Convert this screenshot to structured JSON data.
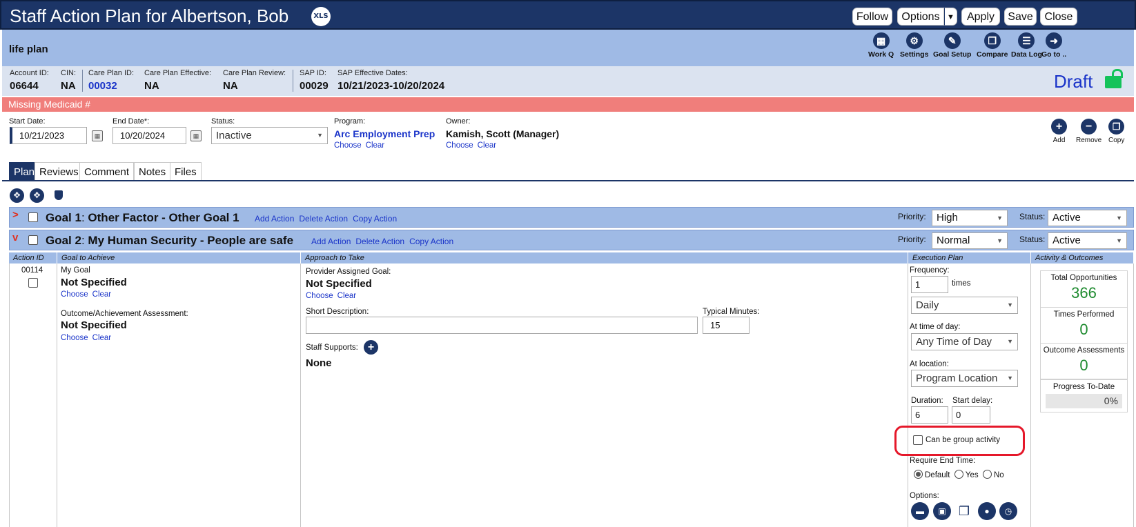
{
  "window": {
    "title": "Staff Action Plan for Albertson, Bob",
    "xls_badge": "XLS",
    "buttons": {
      "follow": "Follow",
      "options": "Options",
      "apply": "Apply",
      "save": "Save",
      "close": "Close"
    }
  },
  "plan_header": {
    "title": "life plan",
    "tools": [
      "Work Q",
      "Settings",
      "Goal Setup",
      "Compare",
      "Data Log",
      "Go to .."
    ]
  },
  "info": {
    "account_id": {
      "label": "Account ID:",
      "value": "06644"
    },
    "cin": {
      "label": "CIN:",
      "value": "NA"
    },
    "care_plan_id": {
      "label": "Care Plan ID:",
      "value": "00032"
    },
    "care_plan_effective": {
      "label": "Care Plan Effective:",
      "value": "NA"
    },
    "care_plan_review": {
      "label": "Care Plan Review:",
      "value": "NA"
    },
    "sap_id": {
      "label": "SAP ID:",
      "value": "00029"
    },
    "sap_effective": {
      "label": "SAP Effective Dates:",
      "value": "10/21/2023-10/20/2024"
    },
    "state": "Draft"
  },
  "alert": "Missing Medicaid #",
  "form": {
    "start_date": {
      "label": "Start Date:",
      "value": "10/21/2023"
    },
    "end_date": {
      "label": "End Date*:",
      "value": "10/20/2024"
    },
    "status": {
      "label": "Status:",
      "value": "Inactive"
    },
    "program": {
      "label": "Program:",
      "value": "Arc Employment Prep"
    },
    "owner": {
      "label": "Owner:",
      "value": "Kamish, Scott (Manager)"
    },
    "choose": "Choose",
    "clear": "Clear",
    "tools": {
      "add": "Add",
      "remove": "Remove",
      "copy": "Copy"
    }
  },
  "tabs": [
    "Plan",
    "Reviews",
    "Comment",
    "Notes",
    "Files"
  ],
  "goals": [
    {
      "num": "Goal 1",
      "name": "Other Factor - Other Goal 1",
      "priority": "High",
      "status": "Active"
    },
    {
      "num": "Goal 2",
      "name": "My Human Security - People are safe",
      "priority": "Normal",
      "status": "Active"
    }
  ],
  "goal_actions": {
    "add": "Add Action",
    "delete": "Delete Action",
    "copy": "Copy Action"
  },
  "goal_labels": {
    "priority": "Priority:",
    "status": "Status:"
  },
  "columns": {
    "action_id": "Action ID",
    "goal_to_achieve": "Goal to Achieve",
    "approach": "Approach to Take",
    "execution": "Execution Plan",
    "activity": "Activity & Outcomes"
  },
  "action": {
    "id": "00114",
    "my_goal_label": "My Goal",
    "my_goal_value": "Not Specified",
    "outcome_label": "Outcome/Achievement Assessment:",
    "outcome_value": "Not Specified",
    "provider_goal_label": "Provider Assigned Goal:",
    "provider_goal_value": "Not Specified",
    "short_desc_label": "Short Description:",
    "short_desc_value": "",
    "typical_minutes_label": "Typical Minutes:",
    "typical_minutes_value": "15",
    "staff_supports_label": "Staff Supports:",
    "staff_supports_value": "None"
  },
  "execution": {
    "frequency_label": "Frequency:",
    "frequency_value": "1",
    "times": "times",
    "period": "Daily",
    "time_of_day_label": "At time of day:",
    "time_of_day": "Any Time of Day",
    "location_label": "At location:",
    "location": "Program Location",
    "duration_label": "Duration:",
    "duration": "6",
    "start_delay_label": "Start delay:",
    "start_delay": "0",
    "group_activity": "Can be group activity",
    "require_end_label": "Require End Time:",
    "require_end_options": [
      "Default",
      "Yes",
      "No"
    ],
    "options_label": "Options:"
  },
  "activity": {
    "total_opps_label": "Total Opportunities",
    "total_opps": "366",
    "times_performed_label": "Times Performed",
    "times_performed": "0",
    "outcome_assess_label": "Outcome Assessments",
    "outcome_assess": "0",
    "progress_label": "Progress To-Date",
    "progress": "0%"
  },
  "colors": {
    "navy": "#1c3567",
    "band": "#9fbae5",
    "alert": "#f07e7b",
    "link": "#1a34c9",
    "stat": "#1d8a2e",
    "highlight": "#e5182a"
  }
}
